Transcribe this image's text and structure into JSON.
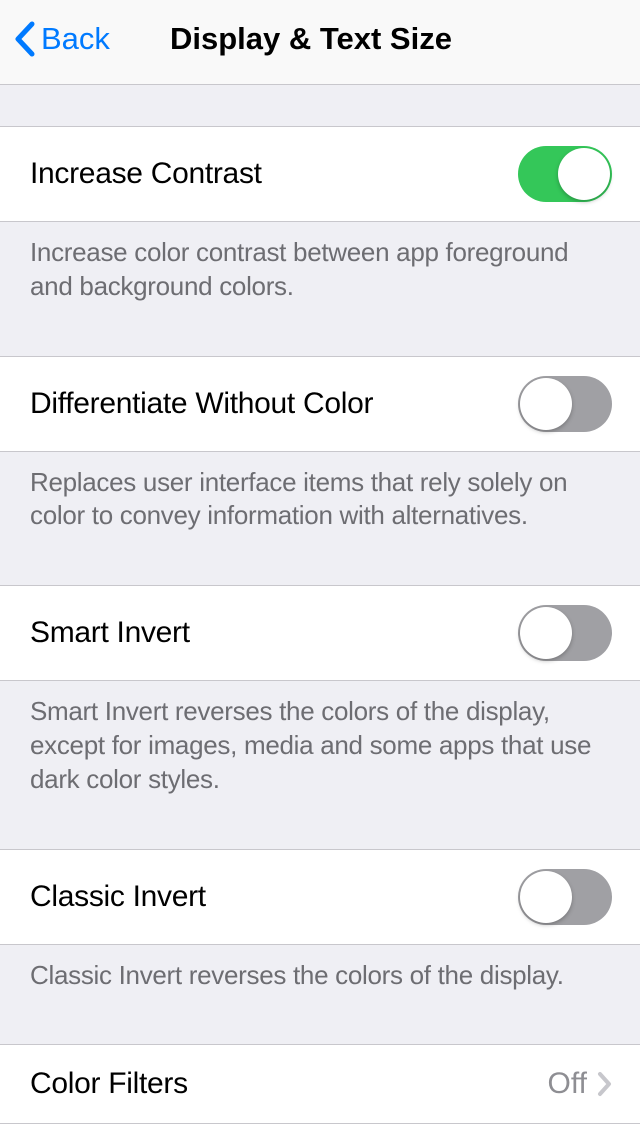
{
  "nav": {
    "back_label": "Back",
    "title": "Display & Text Size"
  },
  "sections": {
    "increase_contrast": {
      "label": "Increase Contrast",
      "on": true,
      "footer": "Increase color contrast between app foreground and background colors."
    },
    "differentiate_without_color": {
      "label": "Differentiate Without Color",
      "on": false,
      "footer": "Replaces user interface items that rely solely on color to convey information with alternatives."
    },
    "smart_invert": {
      "label": "Smart Invert",
      "on": false,
      "footer": "Smart Invert reverses the colors of the display, except for images, media and some apps that use dark color styles."
    },
    "classic_invert": {
      "label": "Classic Invert",
      "on": false,
      "footer": "Classic Invert reverses the colors of the display."
    },
    "color_filters": {
      "label": "Color Filters",
      "value": "Off"
    }
  }
}
